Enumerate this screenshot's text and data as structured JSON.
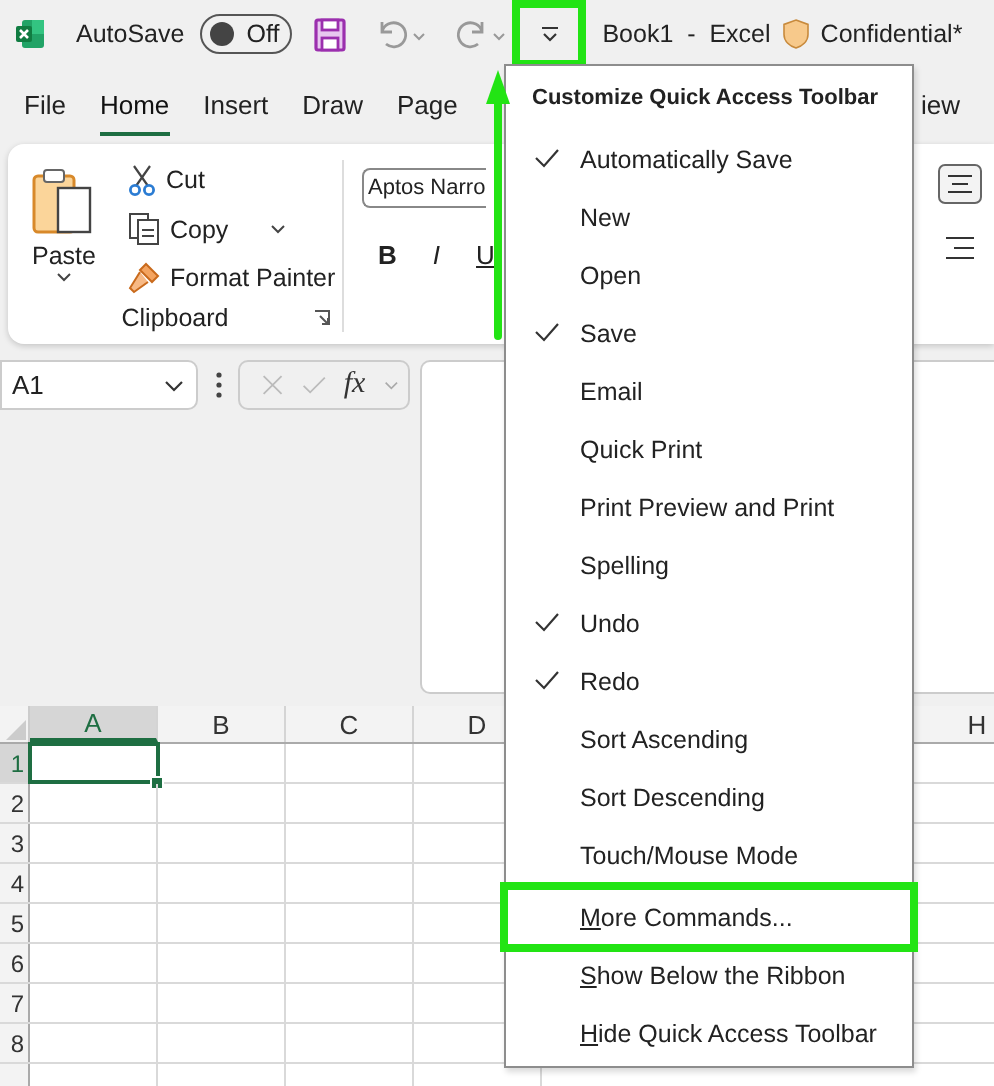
{
  "title_bar": {
    "autosave_label": "AutoSave",
    "autosave_toggle": {
      "label": "Off",
      "on": false
    },
    "customize_button": {
      "highlighted": true
    },
    "document_title": "Book1  -  Excel",
    "sensitivity_label": "Confidential*"
  },
  "ribbon_tabs": [
    {
      "label": "File",
      "selected": false
    },
    {
      "label": "Home",
      "selected": true
    },
    {
      "label": "Insert",
      "selected": false
    },
    {
      "label": "Draw",
      "selected": false
    },
    {
      "label": "Page",
      "selected": false
    },
    {
      "label": "iew",
      "selected": false
    }
  ],
  "ribbon": {
    "clipboard": {
      "paste": "Paste",
      "cut": "Cut",
      "copy": "Copy",
      "format_painter": "Format Painter",
      "group_label": "Clipboard"
    },
    "font": {
      "font_name": "Aptos Narro",
      "bold": "B",
      "italic": "I",
      "underline": "U"
    }
  },
  "formula_bar": {
    "name_box": "A1",
    "function_label": "fx"
  },
  "grid": {
    "columns": [
      {
        "label": "A",
        "selected": true
      },
      {
        "label": "B",
        "selected": false
      },
      {
        "label": "C",
        "selected": false
      },
      {
        "label": "D",
        "selected": false
      },
      {
        "label": "H",
        "selected": false
      }
    ],
    "rows": [
      {
        "label": "1",
        "selected": true
      },
      {
        "label": "2",
        "selected": false
      },
      {
        "label": "3",
        "selected": false
      },
      {
        "label": "4",
        "selected": false
      },
      {
        "label": "5",
        "selected": false
      },
      {
        "label": "6",
        "selected": false
      },
      {
        "label": "7",
        "selected": false
      },
      {
        "label": "8",
        "selected": false
      }
    ]
  },
  "menu": {
    "title": "Customize Quick Access Toolbar",
    "items": [
      {
        "kind": "toggle",
        "label": "Automatically Save",
        "checked": true,
        "highlighted": false
      },
      {
        "kind": "toggle",
        "label": "New",
        "checked": false,
        "highlighted": false
      },
      {
        "kind": "toggle",
        "label": "Open",
        "checked": false,
        "highlighted": false
      },
      {
        "kind": "toggle",
        "label": "Save",
        "checked": true,
        "highlighted": false
      },
      {
        "kind": "toggle",
        "label": "Email",
        "checked": false,
        "highlighted": false
      },
      {
        "kind": "toggle",
        "label": "Quick Print",
        "checked": false,
        "highlighted": false
      },
      {
        "kind": "toggle",
        "label": "Print Preview and Print",
        "checked": false,
        "highlighted": false
      },
      {
        "kind": "toggle",
        "label": "Spelling",
        "checked": false,
        "highlighted": false
      },
      {
        "kind": "toggle",
        "label": "Undo",
        "checked": true,
        "highlighted": false
      },
      {
        "kind": "toggle",
        "label": "Redo",
        "checked": true,
        "highlighted": false
      },
      {
        "kind": "toggle",
        "label": "Sort Ascending",
        "checked": false,
        "highlighted": false
      },
      {
        "kind": "toggle",
        "label": "Sort Descending",
        "checked": false,
        "highlighted": false
      },
      {
        "kind": "toggle",
        "label": "Touch/Mouse Mode",
        "checked": false,
        "highlighted": false
      },
      {
        "kind": "command",
        "label": "More Commands...",
        "highlighted": true
      },
      {
        "kind": "command",
        "label": "Show Below the Ribbon",
        "highlighted": false
      },
      {
        "kind": "command",
        "label": "Hide Quick Access Toolbar",
        "highlighted": false
      }
    ]
  },
  "annotations": [
    {
      "kind": "arrow"
    }
  ]
}
